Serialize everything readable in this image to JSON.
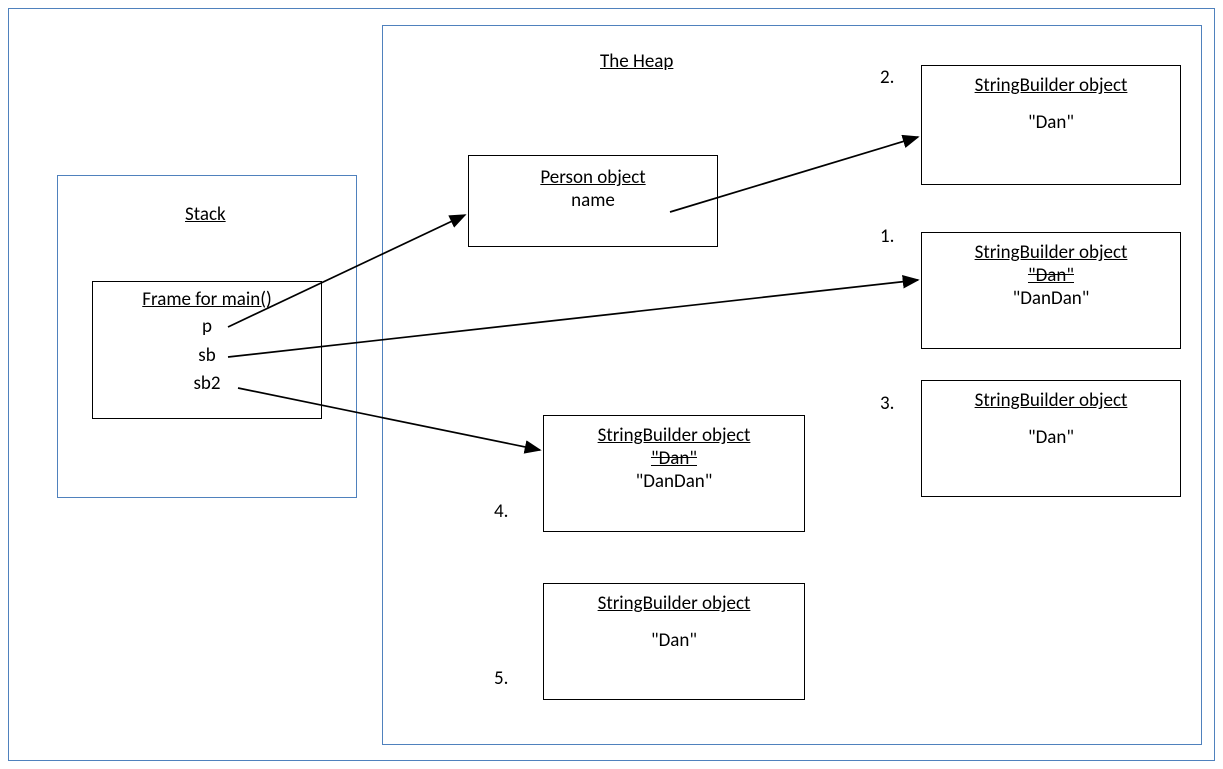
{
  "stack": {
    "title": "Stack",
    "frame": {
      "title": "Frame for main()",
      "vars": [
        "p",
        "sb",
        "sb2"
      ]
    }
  },
  "heap": {
    "title": "The Heap",
    "person": {
      "title": "Person object",
      "field": "name"
    },
    "objects": {
      "sb1": {
        "title": "StringBuilder object",
        "oldValue": "\"Dan\"",
        "newValue": "\"DanDan\"",
        "label": "1."
      },
      "sb2": {
        "title": "StringBuilder object",
        "value": "\"Dan\"",
        "label": "2."
      },
      "sb3": {
        "title": "StringBuilder object",
        "value": "\"Dan\"",
        "label": "3."
      },
      "sb4": {
        "title": "StringBuilder object",
        "oldValue": "\"Dan\"",
        "newValue": "\"DanDan\"",
        "label": "4."
      },
      "sb5": {
        "title": "StringBuilder object",
        "value": "\"Dan\"",
        "label": "5."
      }
    }
  }
}
